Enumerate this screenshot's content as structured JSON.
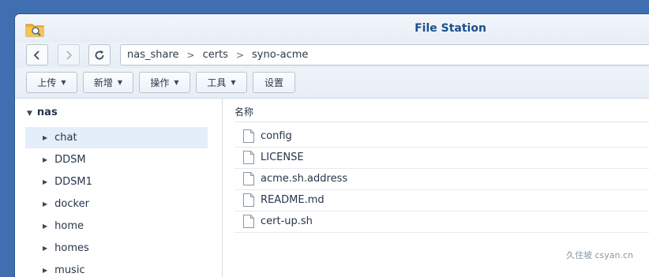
{
  "window": {
    "title": "File Station"
  },
  "nav": {
    "back_icon": "chevron-left-icon",
    "forward_icon": "chevron-right-icon",
    "refresh_icon": "refresh-icon"
  },
  "path": {
    "segments": [
      "nas_share",
      "certs",
      "syno-acme"
    ],
    "separator": ">"
  },
  "toolbar": {
    "upload": "上传",
    "create": "新增",
    "action": "操作",
    "tools": "工具",
    "settings": "设置"
  },
  "sidebar": {
    "root": "nas",
    "items": [
      {
        "label": "chat",
        "selected": true
      },
      {
        "label": "DDSM"
      },
      {
        "label": "DDSM1"
      },
      {
        "label": "docker"
      },
      {
        "label": "home"
      },
      {
        "label": "homes"
      },
      {
        "label": "music"
      }
    ]
  },
  "list": {
    "column_name": "名称",
    "files": [
      "config",
      "LICENSE",
      "acme.sh.address",
      "README.md",
      "cert-up.sh"
    ]
  },
  "watermark": "久住坡 csyan.cn",
  "colors": {
    "title": "#1d4f8c",
    "selected_row": "#e3eef9",
    "desktop": "#3f6fb0"
  }
}
